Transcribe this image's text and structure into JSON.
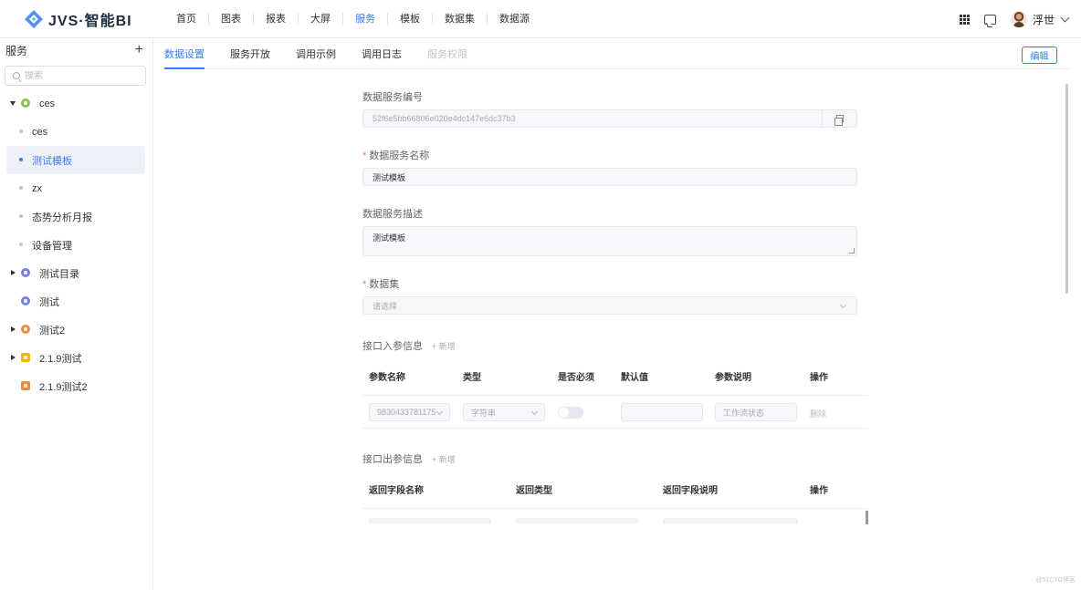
{
  "app": {
    "title": "JVS·智能BI"
  },
  "nav": [
    "首页",
    "图表",
    "报表",
    "大屏",
    "服务",
    "模板",
    "数据集",
    "数据源"
  ],
  "nav_active_index": 4,
  "user": {
    "name": "浮世"
  },
  "sidebar": {
    "title": "服务",
    "add": "+",
    "search_placeholder": "搜索",
    "items": [
      {
        "label": "ces",
        "type": "folder",
        "expanded": true,
        "color": "#8bc34a"
      },
      {
        "label": "ces",
        "type": "leaf"
      },
      {
        "label": "测试模板",
        "type": "leaf",
        "selected": true
      },
      {
        "label": "zx",
        "type": "leaf"
      },
      {
        "label": "态势分析月报",
        "type": "leaf"
      },
      {
        "label": "设备管理",
        "type": "leaf"
      },
      {
        "label": "测试目录",
        "type": "folder",
        "collapsed": true,
        "color": "#7b7fe0"
      },
      {
        "label": "测试",
        "type": "folder",
        "color": "#7b7fe0"
      },
      {
        "label": "测试2",
        "type": "folder",
        "collapsed": true,
        "color": "#f0883a"
      },
      {
        "label": "2.1.9测试",
        "type": "folder",
        "collapsed": true,
        "color": "#f5b400"
      },
      {
        "label": "2.1.9测试2",
        "type": "folder",
        "color": "#f0883a"
      }
    ]
  },
  "tabs": [
    "数据设置",
    "服务开放",
    "调用示例",
    "调用日志",
    "服务权限"
  ],
  "edit_button": "编辑",
  "form": {
    "id_label": "数据服务编号",
    "id_value": "52f6e5bb66806e020e4dc147e6dc37b3",
    "name_label": "数据服务名称",
    "name_value": "测试模板",
    "desc_label": "数据服务描述",
    "desc_value": "测试模板",
    "dataset_label": "数据集",
    "dataset_placeholder": "请选择",
    "required_mark": "*"
  },
  "input_params": {
    "title": "接口入参信息",
    "add": "+ 新增",
    "headers": [
      "参数名称",
      "类型",
      "是否必须",
      "默认值",
      "参数说明",
      "操作"
    ],
    "row": {
      "name": "9830433781175",
      "type": "字符串",
      "default": "",
      "desc_placeholder": "工作流状态",
      "action": "删除"
    }
  },
  "output_params": {
    "title": "接口出参信息",
    "add": "+ 新增",
    "headers": [
      "返回字段名称",
      "返回类型",
      "返回字段说明",
      "操作"
    ]
  },
  "watermark": "@51CTO博客"
}
